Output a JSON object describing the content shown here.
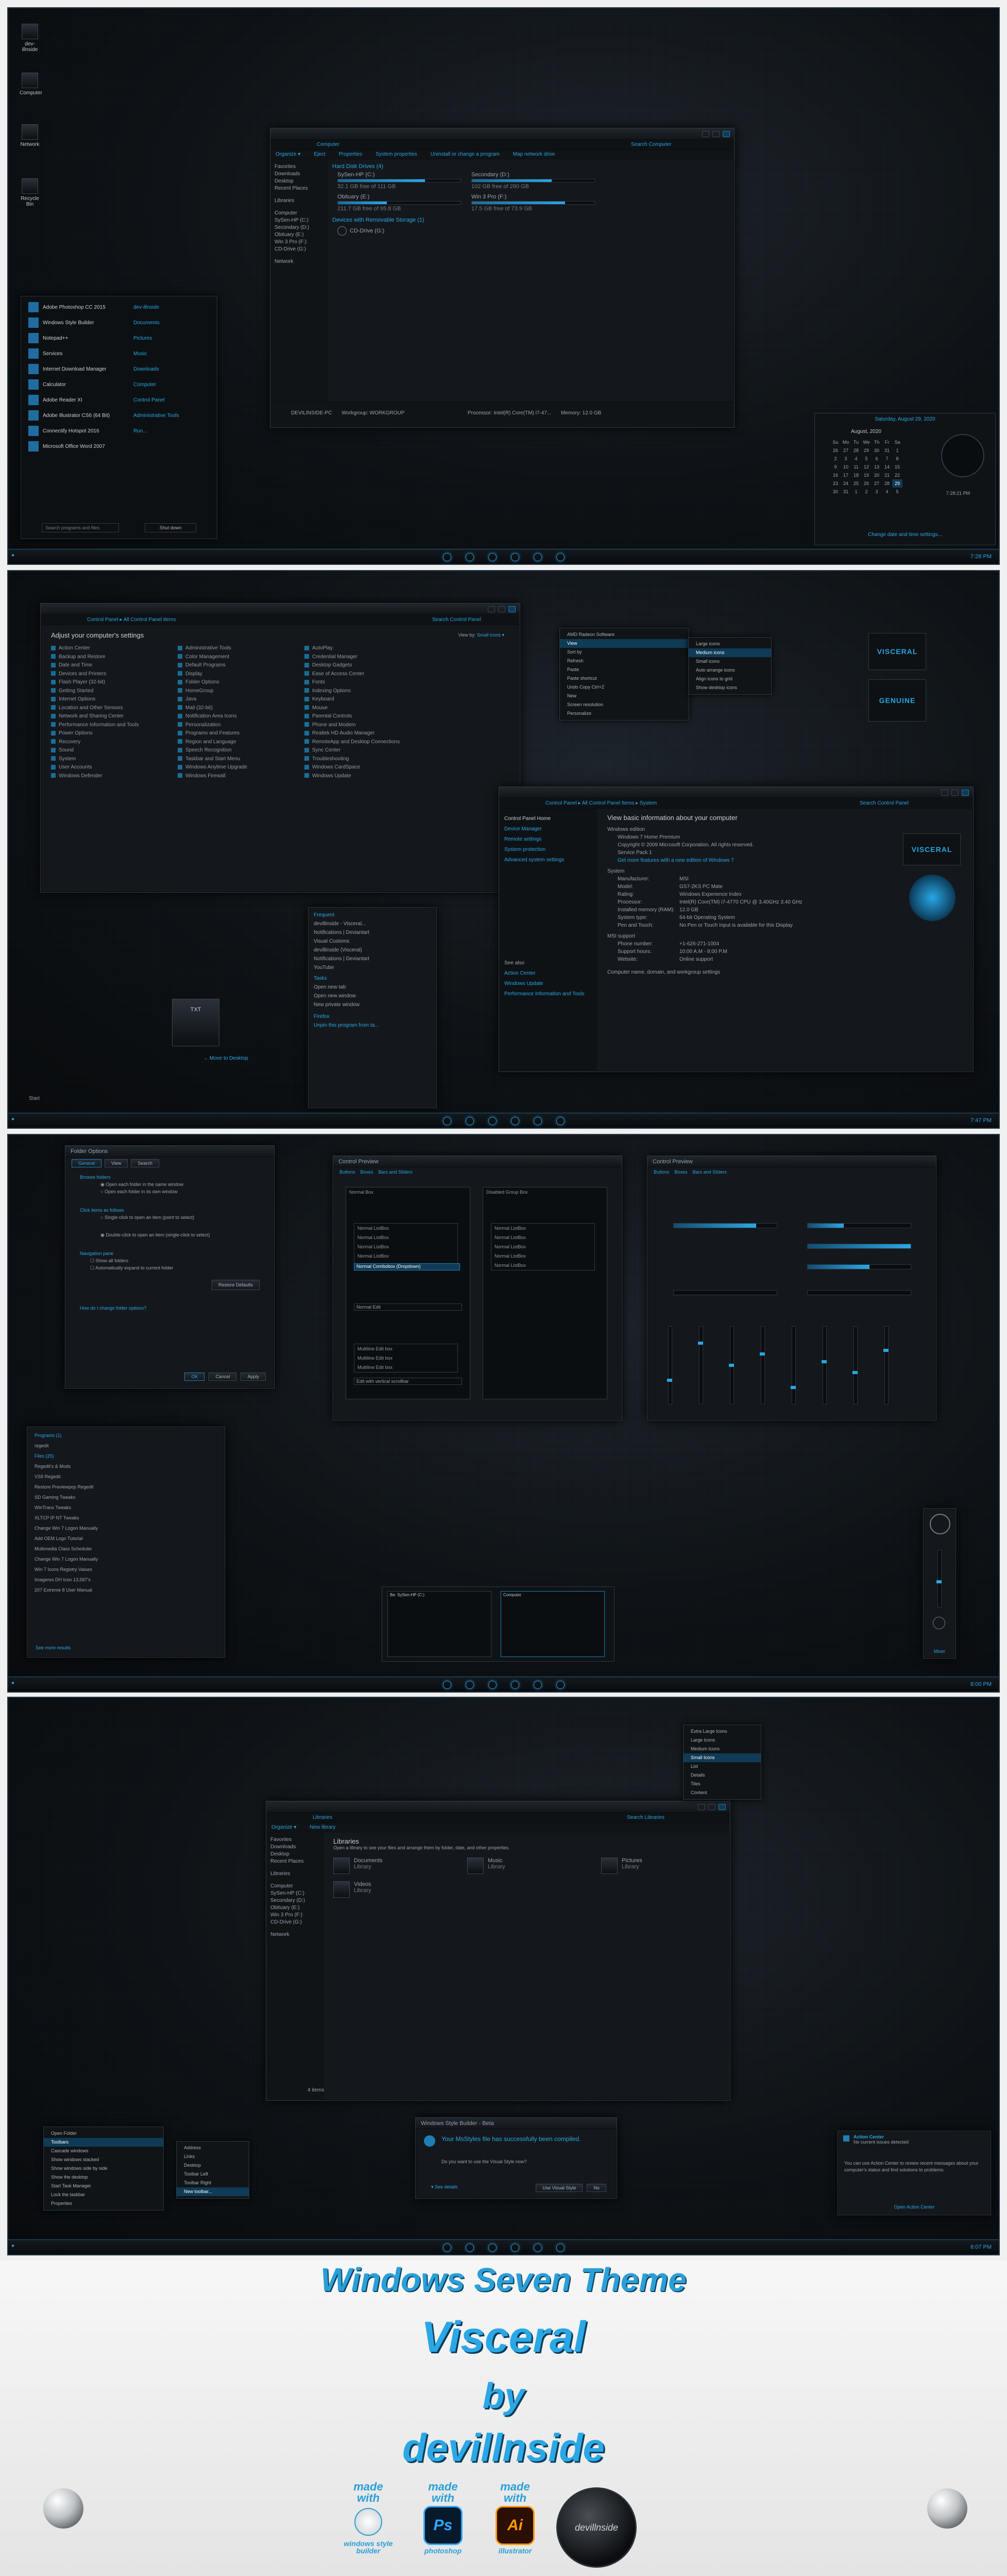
{
  "desktop_icons": [
    {
      "label": "dev-illnside"
    },
    {
      "label": "Computer"
    },
    {
      "label": "Network"
    },
    {
      "label": "Recycle Bin"
    }
  ],
  "panel1": {
    "explorer": {
      "breadcrumb": "Computer",
      "search_placeholder": "Search Computer",
      "toolbar": [
        "Organize ▾",
        "Eject",
        "Properties",
        "System properties",
        "Uninstall or change a program",
        "Map network drive"
      ],
      "nav": [
        "Favorites",
        "Downloads",
        "Desktop",
        "Recent Places",
        "",
        "Libraries",
        "",
        "Computer",
        "SySen-HP (C:)",
        "Secondary (D:)",
        "Obituary (E:)",
        "Win 3 Pro (F:)",
        "CD-Drive (G:)",
        "",
        "Network"
      ],
      "hdd_header": "Hard Disk Drives (4)",
      "drives": [
        {
          "name": "SySen-HP (C:)",
          "free": "32.1 GB free of 111 GB",
          "fill": 0.71
        },
        {
          "name": "Secondary (D:)",
          "free": "102 GB free of 290 GB",
          "fill": 0.65
        },
        {
          "name": "Obituary (E:)",
          "free": "211.7 GB free of 95.8 GB",
          "fill": 0.4
        },
        {
          "name": "Win 3 Pro (F:)",
          "free": "17.5 GB free of 73.9 GB",
          "fill": 0.76
        }
      ],
      "removable_header": "Devices with Removable Storage (1)",
      "removable": "CD-Drive (G:)",
      "status_pc": "DEVILINSIDE-PC",
      "status_wg": "Workgroup: WORKGROUP",
      "status_cpu": "Processor: Intel(R) Core(TM) i7-47...",
      "status_mem": "Memory: 12.0 GB"
    },
    "startmenu": {
      "programs": [
        "Adobe Photoshop CC 2015",
        "Windows Style Builder",
        "Notepad++",
        "Services",
        "Internet Download Manager",
        "Calculator",
        "Adobe Reader XI",
        "Adobe Illustrator CS6 (64 Bit)",
        "Connectify Hotspot 2016",
        "Microsoft Office Word 2007"
      ],
      "places": [
        "dev-illnside",
        "Documents",
        "Pictures",
        "Music",
        "Downloads",
        "Computer",
        "Control Panel",
        "Administrative Tools",
        "Run..."
      ],
      "search": "Search programs and files",
      "shutdown": "Shut down"
    },
    "calendar": {
      "header": "Saturday, August 29, 2020",
      "month": "August, 2020",
      "days": [
        "Su",
        "Mo",
        "Tu",
        "We",
        "Th",
        "Fr",
        "Sa"
      ],
      "rows": [
        [
          "26",
          "27",
          "28",
          "29",
          "30",
          "31",
          "1"
        ],
        [
          "2",
          "3",
          "4",
          "5",
          "6",
          "7",
          "8"
        ],
        [
          "9",
          "10",
          "11",
          "12",
          "13",
          "14",
          "15"
        ],
        [
          "16",
          "17",
          "18",
          "19",
          "20",
          "21",
          "22"
        ],
        [
          "23",
          "24",
          "25",
          "26",
          "27",
          "28",
          "29"
        ],
        [
          "30",
          "31",
          "1",
          "2",
          "3",
          "4",
          "5"
        ]
      ],
      "time": "7:28:21 PM",
      "link": "Change date and time settings..."
    },
    "clock": "7:28 PM"
  },
  "panel2": {
    "cp_breadcrumb": "Control Panel ▸ All Control Panel Items",
    "cp_search": "Search Control Panel",
    "cp_heading": "Adjust your computer's settings",
    "cp_viewby": "View by:",
    "cp_viewby_val": "Small icons ▾",
    "cp_items": [
      "Action Center",
      "Administrative Tools",
      "AutoPlay",
      "Backup and Restore",
      "Color Management",
      "Credential Manager",
      "Date and Time",
      "Default Programs",
      "Desktop Gadgets",
      "Devices and Printers",
      "Display",
      "Ease of Access Center",
      "Flash Player (32-bit)",
      "Folder Options",
      "Fonts",
      "Getting Started",
      "HomeGroup",
      "Indexing Options",
      "Internet Options",
      "Java",
      "Keyboard",
      "Location and Other Sensors",
      "Mail (32-bit)",
      "Mouse",
      "Network and Sharing Center",
      "Notification Area Icons",
      "Parental Controls",
      "Performance Information and Tools",
      "Personalization",
      "Phone and Modem",
      "Power Options",
      "Programs and Features",
      "Realtek HD Audio Manager",
      "Recovery",
      "Region and Language",
      "RemoteApp and Desktop Connections",
      "Sound",
      "Speech Recognition",
      "Sync Center",
      "System",
      "Taskbar and Start Menu",
      "Troubleshooting",
      "User Accounts",
      "Windows Anytime Upgrade",
      "Windows CardSpace",
      "Windows Defender",
      "Windows Firewall",
      "Windows Update"
    ],
    "ctx_menu": [
      "AMD Radeon Software",
      "View",
      "Sort by",
      "Refresh",
      "Paste",
      "Paste shortcut",
      "Undo Copy     Ctrl+Z",
      "New",
      "Screen resolution",
      "Personalize"
    ],
    "ctx_sub": [
      "Large icons",
      "Medium icons",
      "Small icons",
      "Auto arrange icons",
      "Align icons to grid",
      "Show desktop icons"
    ],
    "gadget1": "VISCERAL",
    "gadget2": "GENUINE",
    "sys_breadcrumb": "Control Panel ▸ All Control Panel Items ▸ System",
    "sys_search": "Search Control Panel",
    "sys_nav": [
      "Control Panel Home",
      "Device Manager",
      "Remote settings",
      "System protection",
      "Advanced system settings"
    ],
    "sys_see_also": [
      "See also",
      "Action Center",
      "Windows Update",
      "Performance Information and Tools"
    ],
    "sys_heading": "View basic information about your computer",
    "sys_edition_h": "Windows edition",
    "sys_edition": [
      "Windows 7 Home Premium",
      "Copyright © 2009 Microsoft Corporation. All rights reserved.",
      "Service Pack 1",
      "Get more features with a new edition of Windows 7"
    ],
    "sys_system_h": "System",
    "sys_rows": [
      [
        "Manufacturer:",
        "MSI"
      ],
      [
        "Model:",
        "GS7-2KS PC Mate"
      ],
      [
        "Rating:",
        "Windows Experience Index"
      ],
      [
        "Processor:",
        "Intel(R) Core(TM) i7-4770 CPU @ 3.40GHz   3.40 GHz"
      ],
      [
        "Installed memory (RAM):",
        "12.0 GB"
      ],
      [
        "System type:",
        "64-bit Operating System"
      ],
      [
        "Pen and Touch:",
        "No Pen or Touch Input is available for this Display"
      ]
    ],
    "sys_support_h": "MSI support",
    "sys_support": [
      [
        "Phone number:",
        "+1-626-271-1004"
      ],
      [
        "Support hours:",
        "10:00 A.M - 8:00 P.M"
      ],
      [
        "Website:",
        "Online support"
      ]
    ],
    "sys_footer": "Computer name, domain, and workgroup settings",
    "sys_logo": "VISCERAL",
    "jumplist": {
      "frequent": "Frequent",
      "items": [
        "devillinside - Visceral...",
        "Notifications | Deviantart",
        "Visual Customs",
        "devillinside (Visceral)",
        "Notifications | Deviantart",
        "YouTube"
      ],
      "tasks": "Tasks",
      "task_items": [
        "Open new tab",
        "Open new window",
        "New private window"
      ],
      "footer": [
        "Firefox",
        "Unpin this program from ta..."
      ]
    },
    "txt_label": "TXT",
    "move_label": "→ Move to Desktop",
    "start": "Start",
    "clock": "7:47 PM"
  },
  "panel3": {
    "fo_title": "Folder Options",
    "fo_tabs": [
      "General",
      "View",
      "Search"
    ],
    "fo_browse": "Browse folders",
    "fo_b1": "Open each folder in the same window",
    "fo_b2": "Open each folder in its own window",
    "fo_click": "Click items as follows",
    "fo_c1": "Single-click to open an item (point to select)",
    "fo_c2": "Double-click to open an item (single-click to select)",
    "fo_nav": "Navigation pane",
    "fo_n1": "Show all folders",
    "fo_n2": "Automatically expand to current folder",
    "fo_restore": "Restore Defaults",
    "fo_link": "How do I change folder options?",
    "fo_ok": "OK",
    "fo_cancel": "Cancel",
    "fo_apply": "Apply",
    "cp1_title": "Control Preview",
    "cp1_tabs": [
      "Buttons",
      "Boxes",
      "Bars and Sliders"
    ],
    "cp1_groups": [
      "Normal Box",
      "Disabled Group Box"
    ],
    "cp1_items": [
      "Normal ListBox",
      "Normal ListBox",
      "Normal ListBox",
      "Normal ListBox",
      "Normal ListBox"
    ],
    "cp1_combo": "Normal Combobox (Dropdown)",
    "cp1_edit": "Normal Edit",
    "cp1_multi": [
      "Multiline Edit box",
      "Multiline Edit box",
      "Multiline Edit box"
    ],
    "cp1_scroll": "Edit with vertical scrollbar",
    "cp2_title": "Control Preview",
    "cp2_tabs": [
      "Buttons",
      "Boxes",
      "Bars and Sliders"
    ],
    "search_programs_h": "Programs (1)",
    "search_programs": [
      "regedit"
    ],
    "search_files_h": "Files (25)",
    "search_files": [
      "Regedit's & Mods",
      "VS8 Regedit",
      "Restore Previewpop Regedit",
      "SD Gaming Tweaks",
      "WinTrans Tweaks",
      "XLTCP IP NT Tweaks",
      "Change Win 7 Logon Manually",
      "Add OEM Logo Tutorial",
      "Multimedia Class Scheduler",
      "Change Win 7 Logon Manually",
      "Win 7 Icons Registry Values",
      "Imageres DH Icon 13,587's",
      "207 Extreme 8 User Manual"
    ],
    "search_more": "See more results",
    "thumb1": "Be: SySen-HP (C:)",
    "thumb2": "Computer",
    "gadget_label": "Mixer",
    "clock": "8:00 PM"
  },
  "panel4": {
    "lib_breadcrumb": "Libraries",
    "lib_search": "Search Libraries",
    "lib_toolbar": [
      "Organize ▾",
      "New library"
    ],
    "lib_heading": "Libraries",
    "lib_sub": "Open a library to see your files and arrange them by folder, date, and other properties.",
    "lib_items": [
      [
        "Documents",
        "Library"
      ],
      [
        "Music",
        "Library"
      ],
      [
        "Pictures",
        "Library"
      ],
      [
        "Videos",
        "Library"
      ]
    ],
    "lib_nav": [
      "Favorites",
      "Downloads",
      "Desktop",
      "Recent Places",
      "",
      "Libraries",
      "",
      "Computer",
      "SySen-HP (C:)",
      "Secondary (D:)",
      "Obituary (E:)",
      "Win 3 Pro (F:)",
      "CD-Drive (G:)",
      "",
      "Network"
    ],
    "lib_status": "4 items",
    "view_menu": [
      "Extra Large Icons",
      "Large Icons",
      "Medium Icons",
      "Small Icons",
      "List",
      "Details",
      "Tiles",
      "Content"
    ],
    "tb_ctx": [
      "Open Folder",
      "Toolbars",
      "Cascade windows",
      "Show windows stacked",
      "Show windows side by side",
      "Show the desktop",
      "Start Task Manager",
      "Lock the taskbar",
      "Properties"
    ],
    "tb_sub": [
      "Address",
      "Links",
      "Desktop",
      "Toolbar Left",
      "Toolbar Right",
      "New toolbar..."
    ],
    "wsb_title": "Windows Style Builder - Beta",
    "wsb_msg": "Your MsStyles file has successfully been compiled.",
    "wsb_q": "Do you want to use the Visual Style now?",
    "wsb_details": "▾ See details",
    "wsb_use": "Use Visual Style",
    "wsb_no": "No",
    "ac_title": "Action Center",
    "ac_sub": "No current issues detected",
    "ac_body": "You can use Action Center to review recent messages about your computer's status and find solutions to problems.",
    "ac_link": "Open Action Center",
    "clock": "8:07 PM"
  },
  "banner": {
    "line1": "Windows Seven Theme",
    "line2": "Visceral",
    "line3": "by",
    "line4": "devillnside",
    "badge_lines": [
      "made",
      "with"
    ],
    "captions": [
      "windows style builder",
      "photoshop",
      "illustrator"
    ],
    "ps": "Ps",
    "ai": "Ai",
    "logo_text": "devillnside"
  }
}
